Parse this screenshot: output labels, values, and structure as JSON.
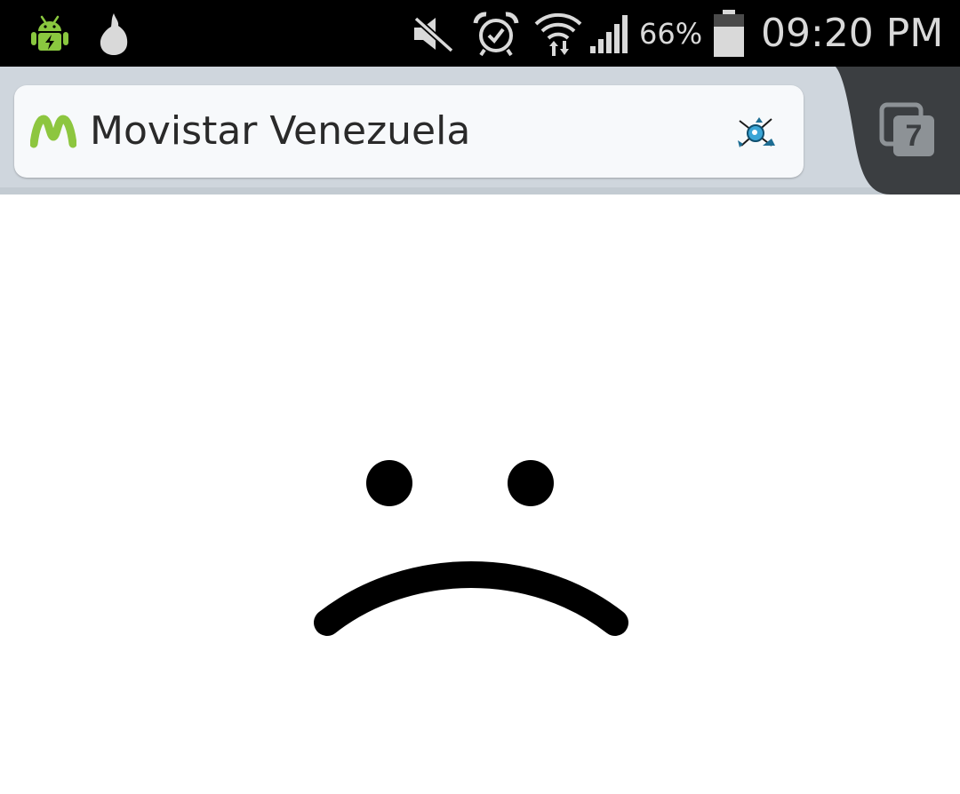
{
  "status_bar": {
    "battery_percent": "66%",
    "time": "09:20 PM",
    "icons": {
      "notification_left": [
        "android-charging-icon",
        "onion-icon"
      ],
      "status_right": [
        "mute-icon",
        "alarm-icon",
        "wifi-icon",
        "signal-icon",
        "battery-icon"
      ]
    }
  },
  "browser": {
    "page_title": "Movistar Venezuela",
    "site_icon": "movistar-logo-icon",
    "action_icon": "satellite-globe-icon",
    "tab_count": "7"
  },
  "colors": {
    "status_bar_bg": "#000000",
    "toolbar_bg": "#cfd6dd",
    "tab_switcher_bg": "#3b3e41",
    "android_green": "#8ac83f",
    "movistar_green": "#8dc63f"
  },
  "content": {
    "illustration": "sad-face-icon"
  }
}
